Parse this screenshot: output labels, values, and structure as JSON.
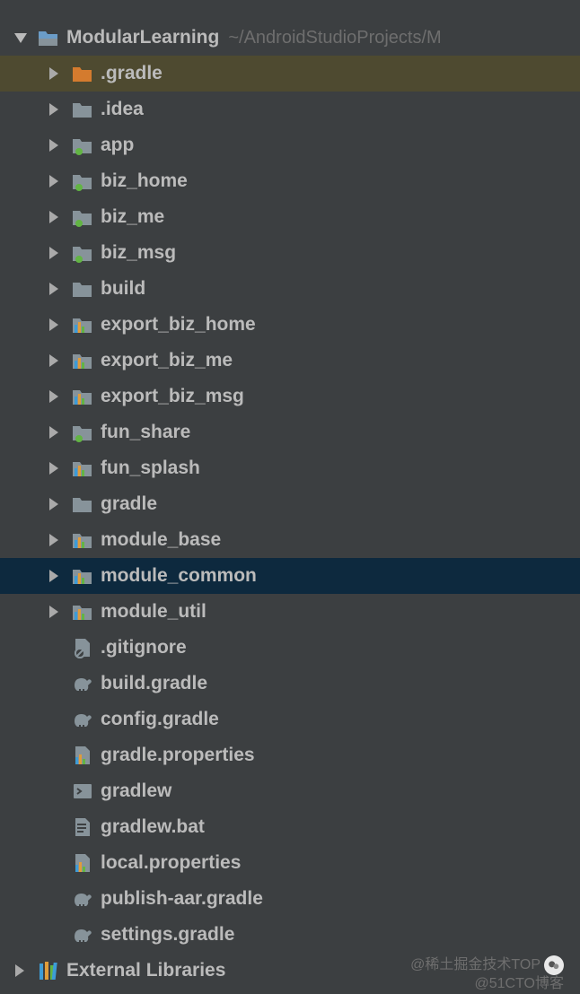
{
  "project": {
    "name": "ModularLearning",
    "path": "~/AndroidStudioProjects/M"
  },
  "tree": {
    "items": [
      {
        "label": ".gradle",
        "icon": "folder-orange",
        "arrow": "right",
        "indent": 1,
        "highlight": "olive"
      },
      {
        "label": ".idea",
        "icon": "folder",
        "arrow": "right",
        "indent": 1
      },
      {
        "label": "app",
        "icon": "module-green",
        "arrow": "right",
        "indent": 1
      },
      {
        "label": "biz_home",
        "icon": "module-green",
        "arrow": "right",
        "indent": 1
      },
      {
        "label": "biz_me",
        "icon": "module-green",
        "arrow": "right",
        "indent": 1
      },
      {
        "label": "biz_msg",
        "icon": "module-green",
        "arrow": "right",
        "indent": 1
      },
      {
        "label": "build",
        "icon": "folder",
        "arrow": "right",
        "indent": 1
      },
      {
        "label": "export_biz_home",
        "icon": "module-bars",
        "arrow": "right",
        "indent": 1
      },
      {
        "label": "export_biz_me",
        "icon": "module-bars",
        "arrow": "right",
        "indent": 1
      },
      {
        "label": "export_biz_msg",
        "icon": "module-bars",
        "arrow": "right",
        "indent": 1
      },
      {
        "label": "fun_share",
        "icon": "module-green",
        "arrow": "right",
        "indent": 1
      },
      {
        "label": "fun_splash",
        "icon": "module-bars",
        "arrow": "right",
        "indent": 1
      },
      {
        "label": "gradle",
        "icon": "folder",
        "arrow": "right",
        "indent": 1
      },
      {
        "label": "module_base",
        "icon": "module-bars",
        "arrow": "right",
        "indent": 1
      },
      {
        "label": "module_common",
        "icon": "module-bars",
        "arrow": "right",
        "indent": 1,
        "highlight": "blue"
      },
      {
        "label": "module_util",
        "icon": "module-bars",
        "arrow": "right",
        "indent": 1
      },
      {
        "label": ".gitignore",
        "icon": "file-ignore",
        "arrow": "none",
        "indent": 1
      },
      {
        "label": "build.gradle",
        "icon": "gradle-elephant",
        "arrow": "none",
        "indent": 1
      },
      {
        "label": "config.gradle",
        "icon": "gradle-elephant",
        "arrow": "none",
        "indent": 1
      },
      {
        "label": "gradle.properties",
        "icon": "properties",
        "arrow": "none",
        "indent": 1
      },
      {
        "label": "gradlew",
        "icon": "terminal",
        "arrow": "none",
        "indent": 1
      },
      {
        "label": "gradlew.bat",
        "icon": "file",
        "arrow": "none",
        "indent": 1
      },
      {
        "label": "local.properties",
        "icon": "properties",
        "arrow": "none",
        "indent": 1
      },
      {
        "label": "publish-aar.gradle",
        "icon": "gradle-elephant",
        "arrow": "none",
        "indent": 1
      },
      {
        "label": "settings.gradle",
        "icon": "gradle-elephant",
        "arrow": "none",
        "indent": 1
      }
    ]
  },
  "external_libraries_label": "External Libraries",
  "watermark": {
    "line1": "@稀土掘金技术TOP",
    "line2": "@51CTO博客"
  }
}
